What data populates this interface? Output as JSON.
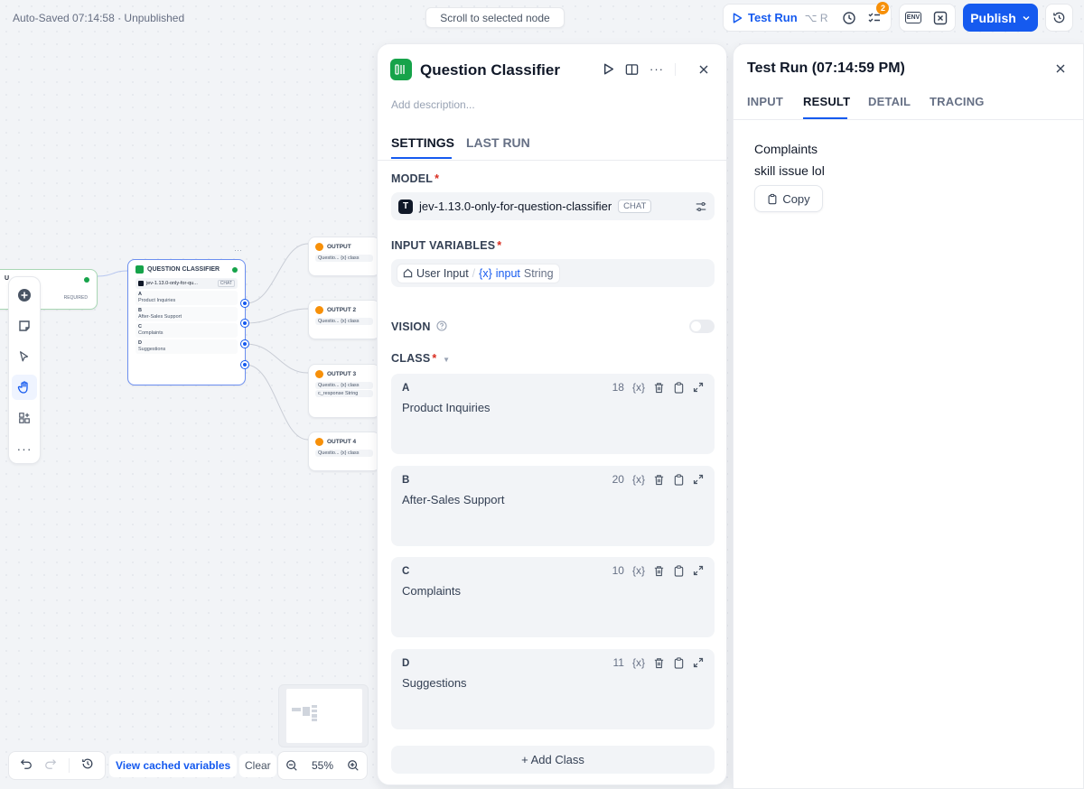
{
  "topbar": {
    "autosave": "Auto-Saved 07:14:58 · Unpublished",
    "scroll_to_node": "Scroll to selected node",
    "test_run": "Test Run",
    "test_run_shortcut": "⌥ R",
    "checklist_badge": "2",
    "env_label": "ENV",
    "publish": "Publish"
  },
  "canvas": {
    "start_node": {
      "label": "U",
      "required": "REQUIRED"
    },
    "qc_node": {
      "title": "QUESTION CLASSIFIER",
      "model": "jev-1.13.0-only-for-qu...",
      "model_tag": "CHAT",
      "classes": [
        {
          "letter": "A",
          "label": "Product Inquiries"
        },
        {
          "letter": "B",
          "label": "After-Sales Support"
        },
        {
          "letter": "C",
          "label": "Complaints"
        },
        {
          "letter": "D",
          "label": "Suggestions"
        }
      ]
    },
    "outputs": [
      {
        "title": "OUTPUT",
        "row1": "Questio...  {x} class"
      },
      {
        "title": "OUTPUT 2",
        "row1": "Questio...  {x} class"
      },
      {
        "title": "OUTPUT 3",
        "row1": "Questio...  {x} class",
        "row2": "c_response String"
      },
      {
        "title": "OUTPUT 4",
        "row1": "Questio...  {x} class"
      }
    ]
  },
  "bottombar": {
    "view_cached": "View cached variables",
    "clear": "Clear",
    "zoom": "55%"
  },
  "node_panel": {
    "title": "Question Classifier",
    "description_placeholder": "Add description...",
    "tabs": [
      "SETTINGS",
      "LAST RUN"
    ],
    "model_label": "MODEL",
    "model_name": "jev-1.13.0-only-for-question-classifier",
    "model_logo": "T",
    "model_tag": "CHAT",
    "input_vars_label": "INPUT VARIABLES",
    "input_var": {
      "source": "User Input",
      "name": "input",
      "type": "String"
    },
    "vision_label": "VISION",
    "class_label": "CLASS",
    "classes": [
      {
        "letter": "A",
        "text": "Product Inquiries",
        "count": "18"
      },
      {
        "letter": "B",
        "text": "After-Sales Support",
        "count": "20"
      },
      {
        "letter": "C",
        "text": "Complaints",
        "count": "10"
      },
      {
        "letter": "D",
        "text": "Suggestions",
        "count": "11"
      }
    ],
    "var_token": "{x}",
    "add_class": "+ Add Class"
  },
  "run_panel": {
    "title": "Test Run (07:14:59 PM)",
    "tabs": [
      "INPUT",
      "RESULT",
      "DETAIL",
      "TRACING"
    ],
    "output_line1": "Complaints",
    "output_line2": "skill issue lol",
    "copy": "Copy"
  }
}
